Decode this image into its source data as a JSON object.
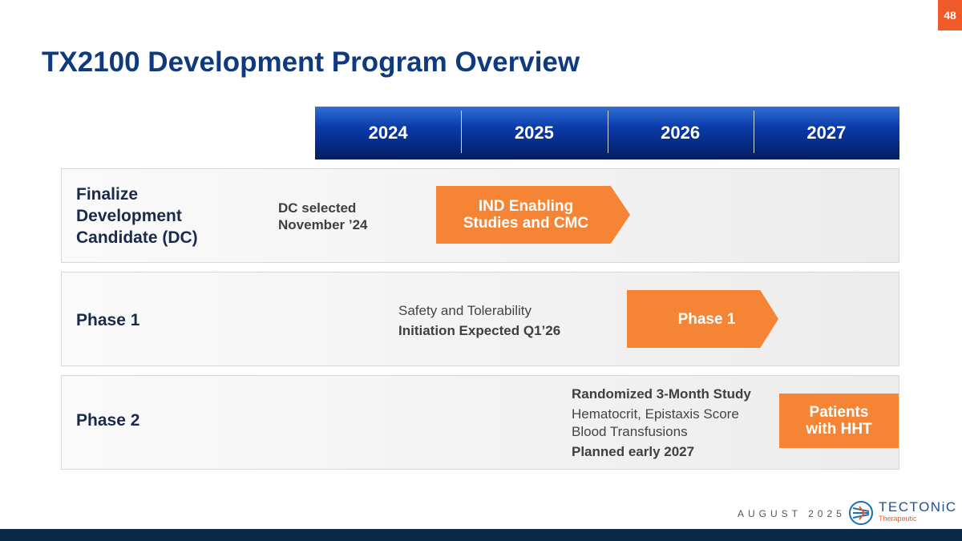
{
  "page_number": "48",
  "title": "TX2100 Development Program Overview",
  "timeline": {
    "years": [
      "2024",
      "2025",
      "2026",
      "2027"
    ]
  },
  "rows": [
    {
      "label_lines": [
        "Finalize",
        "Development",
        "Candidate (DC)"
      ],
      "note_lines": [
        "DC selected",
        "November ’24"
      ],
      "arrow_lines": [
        "IND Enabling",
        "Studies and CMC"
      ]
    },
    {
      "label": "Phase 1",
      "note_normal": "Safety and Tolerability",
      "note_bold": "Initiation Expected Q1’26",
      "arrow": "Phase 1"
    },
    {
      "label": "Phase 2",
      "note_bold_1": "Randomized 3-Month Study",
      "note_normal_1": "Hematocrit, Epistaxis Score",
      "note_normal_2": "Blood Transfusions",
      "note_bold_2": "Planned early 2027",
      "box_lines": [
        "Patients",
        "with HHT"
      ]
    }
  ],
  "footer": {
    "date": "AUGUST 2025",
    "logo_word": "TECTONiC",
    "logo_sub": "Therapeutic"
  },
  "colors": {
    "accent": "#f05a28",
    "arrow": "#f58535",
    "title": "#0f3a7d",
    "bar": "#0a3aa8",
    "footer_bar": "#0b2a4a"
  },
  "icons": {
    "logo": "tectonic-logo-icon"
  }
}
